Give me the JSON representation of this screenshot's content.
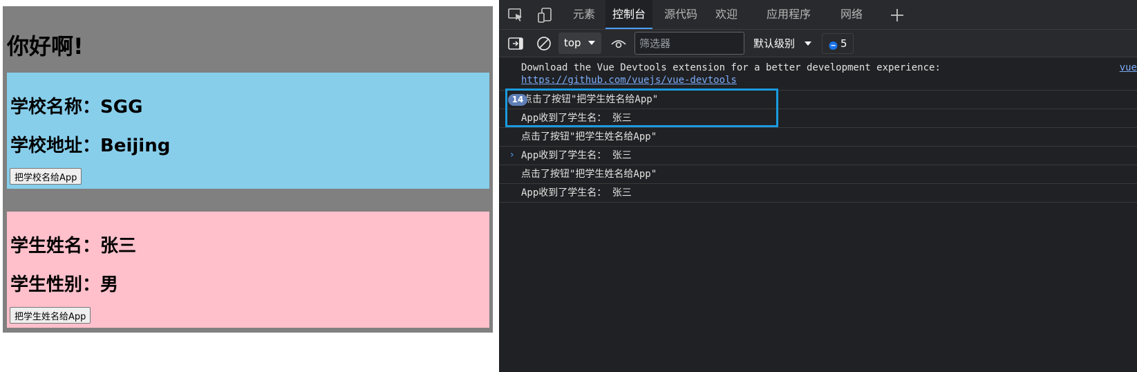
{
  "app": {
    "title": "你好啊!",
    "school": {
      "name_line": "学校名称：SGG",
      "address_line": "学校地址：Beijing",
      "button_label": "把学校名给App",
      "background": "#87ceeb"
    },
    "student": {
      "name_line": "学生姓名：张三",
      "gender_line": "学生性别：男",
      "button_label": "把学生姓名给App",
      "background": "#ffc0cb"
    },
    "frame_background": "#808080"
  },
  "devtools": {
    "tabs": [
      "元素",
      "控制台",
      "源代码",
      "欢迎",
      "应用程序",
      "网络"
    ],
    "active_tab": "控制台",
    "toolbar": {
      "context": "top",
      "filter_placeholder": "筛选器",
      "level": "默认级别",
      "issues_count": "5"
    },
    "console": {
      "devtools_message": "Download the Vue Devtools extension for a better development experience:",
      "devtools_link": "https://github.com/vuejs/vue-devtools",
      "devtools_source": "vue",
      "repeat_count": "14",
      "lines": [
        "点击了按钮\"把学生姓名给App\"",
        "App收到了学生名： 张三",
        "点击了按钮\"把学生姓名给App\"",
        "App收到了学生名： 张三",
        "点击了按钮\"把学生姓名给App\"",
        "App收到了学生名： 张三"
      ],
      "prompt": "›"
    },
    "highlight_color": "#1a9be0"
  }
}
